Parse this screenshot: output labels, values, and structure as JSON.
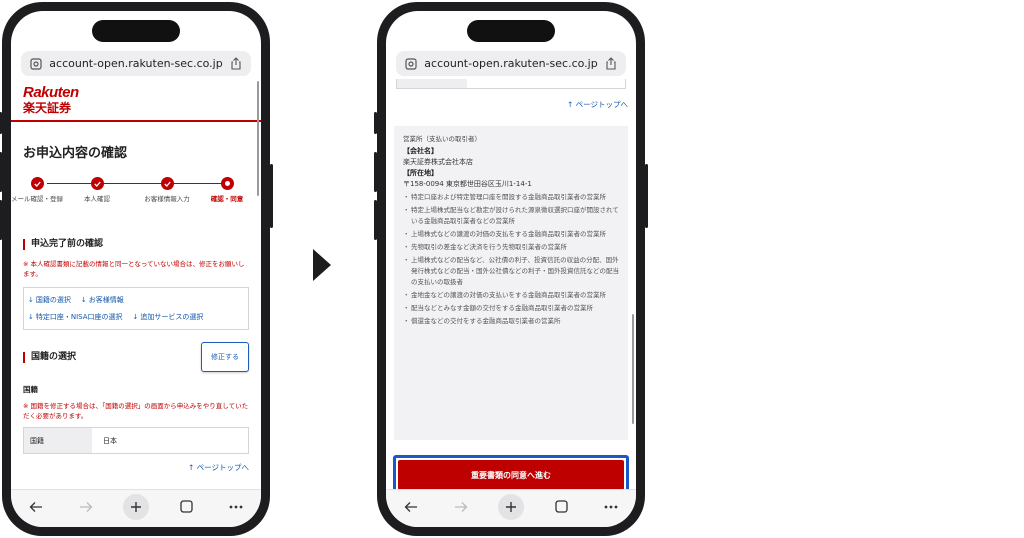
{
  "left": {
    "url": "account-open.rakuten-sec.co.jp",
    "logo_en": "Rakuten",
    "logo_jp": "楽天証券",
    "page_title": "お申込内容の確認",
    "steps": [
      {
        "label": "メール確認・登録"
      },
      {
        "label": "本人確認"
      },
      {
        "label": "お客様情報入力"
      },
      {
        "label": "確認・同意"
      }
    ],
    "section_heading": "申込完了前の確認",
    "note": "※ 本人確認書類に記載の情報と同一となっていない場合は、修正をお願いします。",
    "anchors": [
      "国籍の選択",
      "お客様情報",
      "特定口座・NISA口座の選択",
      "追加サービスの選択"
    ],
    "nationality_heading": "国籍の選択",
    "edit_label": "修正する",
    "field_title": "国籍",
    "nationality_note": "※ 国籍を修正する場合は、「国籍の選択」の画面から申込みをやり直していただく必要があります。",
    "kv_key": "国籍",
    "kv_value": "日本",
    "page_top": "ページトップへ",
    "arrow_up": "↑",
    "arrow_down": "↓"
  },
  "right": {
    "url": "account-open.rakuten-sec.co.jp",
    "page_top": "ページトップへ",
    "arrow_up": "↑",
    "bullet_mark": "・",
    "office_type": "営業所（支払いの取引者）",
    "company_label": "【会社名】",
    "company_name": "楽天証券株式会社本店",
    "address_label": "【所在地】",
    "address": "〒158-0094 東京都世田谷区玉川1-14-1",
    "bullets": [
      "特定口座および特定管理口座を開設する金融商品取引業者の営業所",
      "特定上場株式配当など勘定が設けられた源泉徴収選択口座が開設されている金融商品取引業者などの営業所",
      "上場株式などの譲渡の対価の支払をする金融商品取引業者の営業所",
      "先物取引の差金など決済を行う先物取引業者の営業所",
      "上場株式などの配当など、公社債の利子、投資信託の収益の分配、国外発行株式などの配当・国外公社債などの利子・国外投資信託などの配当の支払いの取扱者",
      "金地金などの譲渡の対価の支払いをする金融商品取引業者の営業所",
      "配当などとみなす金額の交付をする金融商品取引業者の営業所",
      "償還金などの交付をする金融商品取引業者の営業所"
    ],
    "proceed_label": "重要書類の同意へ進む"
  }
}
